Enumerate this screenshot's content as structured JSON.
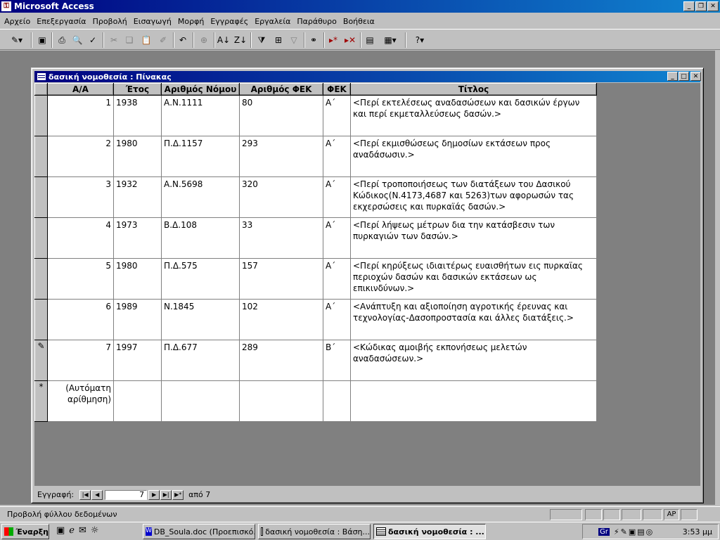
{
  "app": {
    "title": "Microsoft Access"
  },
  "menu": [
    "Αρχείο",
    "Επεξεργασία",
    "Προβολή",
    "Εισαγωγή",
    "Μορφή",
    "Εγγραφές",
    "Εργαλεία",
    "Παράθυρο",
    "Βοήθεια"
  ],
  "window": {
    "title": "δασική νομοθεσία : Πίνακας"
  },
  "table": {
    "headers": [
      "Α/Α",
      "Έτος",
      "Αριθμός Νόμου",
      "Αριθμός  ΦΕΚ",
      "ΦΕΚ",
      "Τίτλος"
    ],
    "rows": [
      {
        "aa": "1",
        "year": "1938",
        "law": "Α.Ν.1111",
        "fek_no": "80",
        "fek": "Α΄",
        "title": "<Περί εκτελέσεως αναδασώσεων και δασικών έργων και περί εκμεταλλεύσεως δασών.>"
      },
      {
        "aa": "2",
        "year": "1980",
        "law": "Π.Δ.1157",
        "fek_no": "293",
        "fek": "Α΄",
        "title": "<Περί εκμισθώσεως δημοσίων εκτάσεων προς αναδάσωσιν.>"
      },
      {
        "aa": "3",
        "year": "1932",
        "law": "Α.Ν.5698",
        "fek_no": "320",
        "fek": "Α΄",
        "title": "<Περί τροποποιήσεως των διατάξεων του Δασικού Κώδικος(Ν.4173,4687 και 5263)των αφορωσών τας εκχερσώσεις και πυρκαϊάς δασών.>"
      },
      {
        "aa": "4",
        "year": "1973",
        "law": "Β.Δ.108",
        "fek_no": "33",
        "fek": "Α΄",
        "title": "<Περί λήψεως μέτρων δια την κατάσβεσιν των πυρκαγιών των δασών.>"
      },
      {
        "aa": "5",
        "year": "1980",
        "law": "Π.Δ.575",
        "fek_no": "157",
        "fek": "Α΄",
        "title": "<Περί  κηρύξεως ιδιαιτέρως ευαισθήτων εις πυρκαϊας περιοχών δασών και δασικών εκτάσεων ως επικινδύνων.>"
      },
      {
        "aa": "6",
        "year": "1989",
        "law": "Ν.1845",
        "fek_no": "102",
        "fek": "Α΄",
        "title": "<Ανάπτυξη και αξιοποίηση αγροτικής έρευνας και τεχνολογίας-Δασοπροστασία και άλλες διατάξεις.>"
      },
      {
        "aa": "7",
        "year": "1997",
        "law": "Π.Δ.677",
        "fek_no": "289",
        "fek": "Β΄",
        "title": "<Κώδικας αμοιβής εκπονήσεως μελετών αναδασώσεων.>"
      }
    ],
    "new_row_label": "(Αυτόματη αρίθμηση)",
    "new_row_marker": "*",
    "edit_marker": "✎"
  },
  "nav": {
    "label": "Εγγραφή:",
    "current": "7",
    "total_text": "από 7"
  },
  "status": {
    "text": "Προβολή φύλλου δεδομένων",
    "indicator": "ΑΡ"
  },
  "taskbar": {
    "start": "Έναρξη",
    "tasks": [
      "DB_Soula.doc (Προεπισκό...",
      "δασική νομοθεσία : Βάση...",
      "δασική νομοθεσία : ..."
    ],
    "lang": "Gr",
    "clock": "3:53 μμ"
  }
}
